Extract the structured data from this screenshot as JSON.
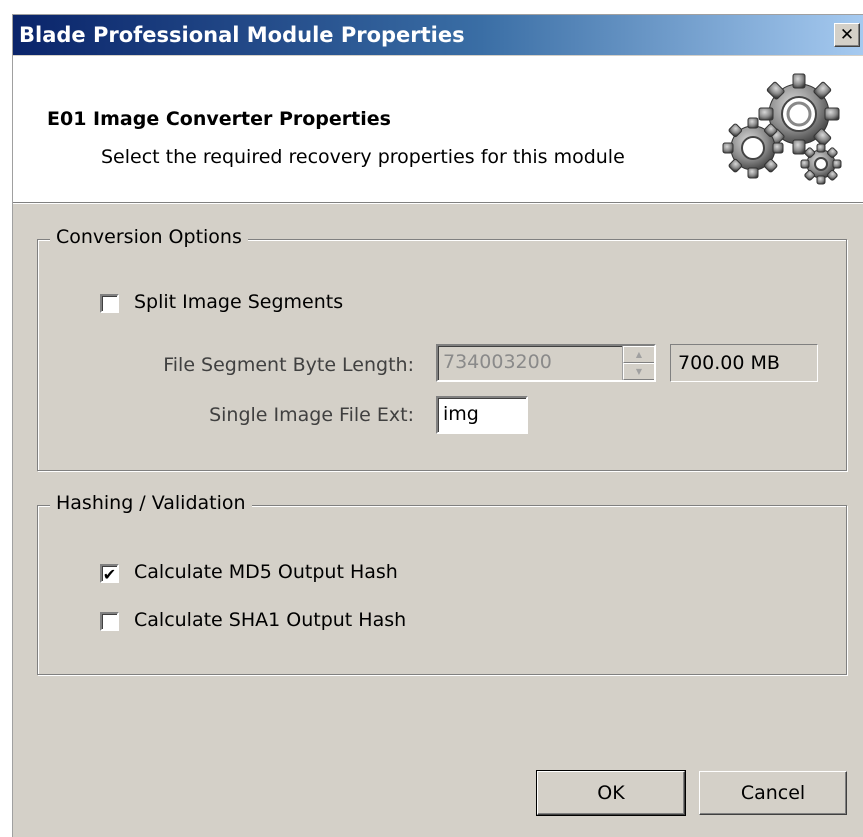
{
  "window": {
    "title": "Blade Professional Module Properties",
    "close_glyph": "✕"
  },
  "header": {
    "title": "E01 Image Converter Properties",
    "subtitle": "Select the required recovery properties for this module",
    "icon": "gears-icon"
  },
  "conversion_options": {
    "label": "Conversion Options",
    "split_segments": {
      "label": "Split Image Segments",
      "checked": false
    },
    "segment_length": {
      "label": "File Segment Byte Length:",
      "value": "734003200",
      "display": "700.00 MB"
    },
    "file_ext": {
      "label": "Single Image File Ext:",
      "value": "img"
    }
  },
  "hashing": {
    "label": "Hashing / Validation",
    "md5": {
      "label": "Calculate MD5 Output Hash",
      "checked": true
    },
    "sha1": {
      "label": "Calculate SHA1 Output Hash",
      "checked": false
    }
  },
  "buttons": {
    "ok": "OK",
    "cancel": "Cancel"
  },
  "glyphs": {
    "checkmark": "✔",
    "spin_up": "▲",
    "spin_down": "▼"
  }
}
